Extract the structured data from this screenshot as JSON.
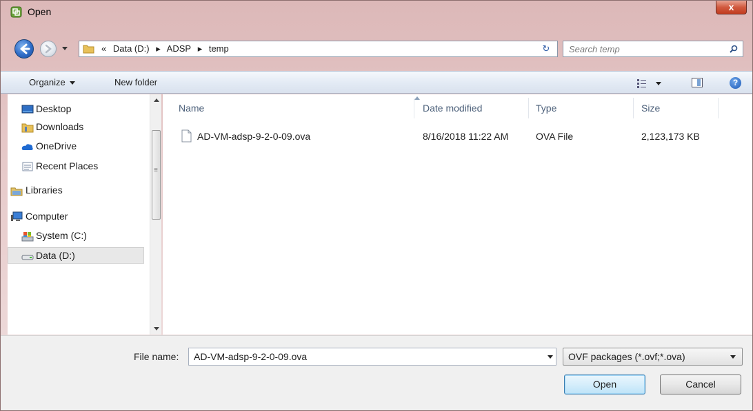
{
  "window": {
    "title": "Open",
    "close_label": "x"
  },
  "address": {
    "crumbs": [
      "«",
      "Data (D:)",
      "▸",
      "ADSP",
      "▸",
      "temp"
    ],
    "refresh_label": "↻",
    "search_placeholder": "Search temp"
  },
  "toolbar": {
    "organize_label": "Organize",
    "new_folder_label": "New folder",
    "help_label": "?"
  },
  "nav": {
    "items": [
      {
        "label": "Desktop",
        "icon": "desktop-icon"
      },
      {
        "label": "Downloads",
        "icon": "folder-icon"
      },
      {
        "label": "OneDrive",
        "icon": "cloud-icon"
      },
      {
        "label": "Recent Places",
        "icon": "recent-places-icon"
      },
      {
        "label": "Libraries",
        "icon": "libraries-icon"
      },
      {
        "label": "Computer",
        "icon": "computer-icon"
      },
      {
        "label": "System (C:)",
        "icon": "drive-icon"
      },
      {
        "label": "Data (D:)",
        "icon": "drive-icon"
      }
    ],
    "selected": "Data (D:)"
  },
  "filelist": {
    "columns": [
      "Name",
      "Date modified",
      "Type",
      "Size"
    ],
    "rows": [
      {
        "name": "AD-VM-adsp-9-2-0-09.ova",
        "date_modified": "8/16/2018 11:22 AM",
        "type": "OVA File",
        "size": "2,123,173 KB"
      }
    ]
  },
  "bottom": {
    "file_name_label": "File name:",
    "file_name_value": "AD-VM-adsp-9-2-0-09.ova",
    "file_type_value": "OVF packages (*.ovf;*.ova)",
    "open_label": "Open",
    "cancel_label": "Cancel"
  },
  "colors": {
    "accent": "#3c7fb1",
    "titlebar": "#dcb8b8",
    "close": "#c13c20"
  }
}
